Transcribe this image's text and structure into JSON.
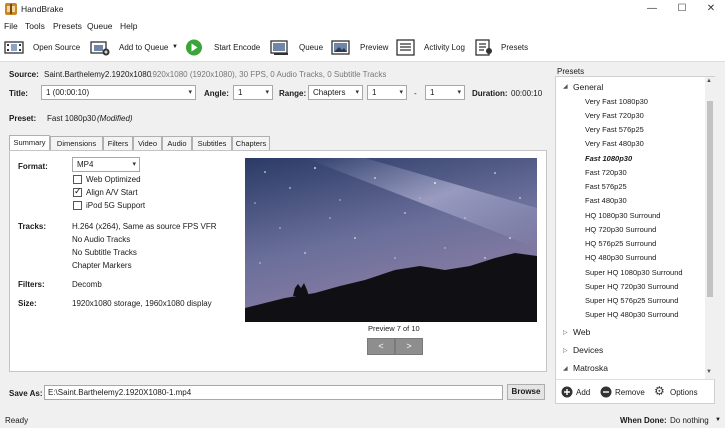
{
  "app": {
    "title": "HandBrake"
  },
  "window_controls": {
    "minimize": "—",
    "maximize": "☐",
    "close": "✕"
  },
  "menu": [
    "File",
    "Tools",
    "Presets",
    "Queue",
    "Help"
  ],
  "toolbar": {
    "open_source": "Open Source",
    "add_to_queue": "Add to Queue",
    "start_encode": "Start Encode",
    "queue": "Queue",
    "preview": "Preview",
    "activity_log": "Activity Log",
    "presets": "Presets"
  },
  "source": {
    "label": "Source:",
    "name": "Saint.Barthelemy2.1920x1080",
    "info": "1920x1080 (1920x1080), 30 FPS, 0 Audio Tracks, 0 Subtitle Tracks"
  },
  "title_row": {
    "title_label": "Title:",
    "title_value": "1 (00:00:10)",
    "angle_label": "Angle:",
    "angle_value": "1",
    "range_label": "Range:",
    "range_value": "Chapters",
    "range_start": "1",
    "range_dash": "-",
    "range_end": "1",
    "duration_label": "Duration:",
    "duration_value": "00:00:10"
  },
  "preset_row": {
    "label": "Preset:",
    "value": "Fast 1080p30",
    "modified": "(Modified)"
  },
  "tabs": [
    "Summary",
    "Dimensions",
    "Filters",
    "Video",
    "Audio",
    "Subtitles",
    "Chapters"
  ],
  "summary": {
    "format_label": "Format:",
    "format_value": "MP4",
    "web_optimized": "Web Optimized",
    "align_av": "Align A/V Start",
    "ipod": "iPod 5G Support",
    "tracks_label": "Tracks:",
    "tracks": [
      "H.264 (x264), Same as source FPS VFR",
      "No Audio Tracks",
      "No Subtitle Tracks",
      "Chapter Markers"
    ],
    "filters_label": "Filters:",
    "filters_value": "Decomb",
    "size_label": "Size:",
    "size_value": "1920x1080 storage, 1960x1080 display",
    "preview_caption": "Preview 7 of 10",
    "prev": "<",
    "next": ">"
  },
  "save": {
    "label": "Save As:",
    "value": "E:\\Saint.Barthelemy2.1920X1080-1.mp4",
    "browse": "Browse"
  },
  "presets_panel": {
    "header": "Presets",
    "groups": [
      {
        "name": "General",
        "expanded": true
      },
      {
        "name": "Web",
        "expanded": false
      },
      {
        "name": "Devices",
        "expanded": false
      },
      {
        "name": "Matroska",
        "expanded": true
      }
    ],
    "general_items": [
      "Very Fast 1080p30",
      "Very Fast 720p30",
      "Very Fast 576p25",
      "Very Fast 480p30",
      "Fast 1080p30",
      "Fast 720p30",
      "Fast 576p25",
      "Fast 480p30",
      "HQ 1080p30 Surround",
      "HQ 720p30 Surround",
      "HQ 576p25 Surround",
      "HQ 480p30 Surround",
      "Super HQ 1080p30 Surround",
      "Super HQ 720p30 Surround",
      "Super HQ 576p25 Surround",
      "Super HQ 480p30 Surround"
    ],
    "selected": "Fast 1080p30",
    "add": "Add",
    "remove": "Remove",
    "options": "Options"
  },
  "status": {
    "left": "Ready",
    "when_done_label": "When Done:",
    "when_done_value": "Do nothing"
  }
}
